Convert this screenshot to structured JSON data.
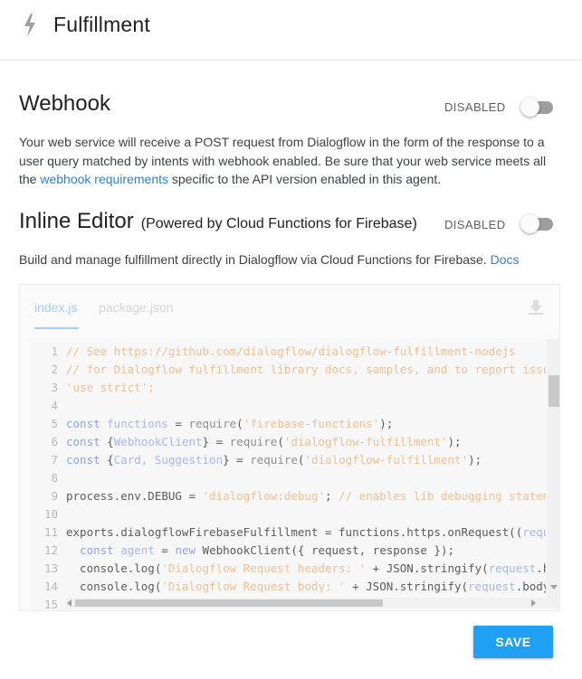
{
  "header": {
    "icon": "bolt-icon",
    "title": "Fulfillment"
  },
  "webhook": {
    "title": "Webhook",
    "toggle_label": "DISABLED",
    "enabled": false,
    "desc_prefix": "Your web service will receive a POST request from Dialogflow in the form of the response to a user query matched by intents with webhook enabled. Be sure that your web service meets all the ",
    "desc_link": "webhook requirements",
    "desc_suffix": " specific to the API version enabled in this agent."
  },
  "inline_editor": {
    "title": "Inline Editor",
    "subtitle": "(Powered by Cloud Functions for Firebase)",
    "toggle_label": "DISABLED",
    "enabled": false,
    "desc_prefix": "Build and manage fulfillment directly in Dialogflow via Cloud Functions for Firebase. ",
    "desc_link": "Docs",
    "tabs": [
      {
        "label": "index.js",
        "active": true
      },
      {
        "label": "package.json",
        "active": false
      }
    ],
    "download_icon": "download-icon",
    "line_numbers": [
      "1",
      "2",
      "3",
      "4",
      "5",
      "6",
      "7",
      "8",
      "9",
      "10",
      "11",
      "12",
      "13",
      "14",
      "15"
    ]
  },
  "actions": {
    "save_label": "SAVE"
  },
  "colors": {
    "accent": "#1ea1f2",
    "link": "#2f7fd8",
    "toggle_off": "#9e9e9e"
  }
}
